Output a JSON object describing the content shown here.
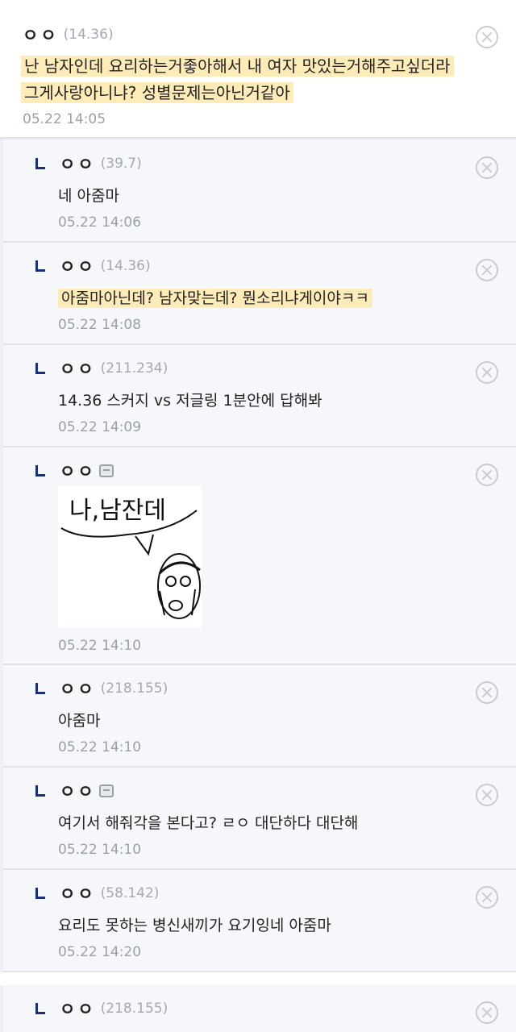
{
  "top_comment": {
    "nick": "ㅇㅇ",
    "ip": "(14.36)",
    "body_line1": "난 남자인데 요리하는거좋아해서 내 여자 맛있는거해주고싶더라",
    "body_line2": "그게사랑아니냐? 성별문제는아닌거같아",
    "date": "05.22 14:05"
  },
  "replies": [
    {
      "nick": "ㅇㅇ",
      "ip": "(39.7)",
      "body": "네 아줌마",
      "date": "05.22 14:06"
    },
    {
      "nick": "ㅇㅇ",
      "ip": "(14.36)",
      "body": "아줌마아닌데? 남자맞는데? 뭔소리냐게이야ㅋㅋ",
      "date": "05.22 14:08"
    },
    {
      "nick": "ㅇㅇ",
      "ip": "(211.234)",
      "body": "14.36 스커지 vs 저글링 1분안에 답해봐",
      "date": "05.22 14:09"
    },
    {
      "nick": "ㅇㅇ",
      "ip": "",
      "body": "",
      "image_text": "나,남잔데",
      "date": "05.22 14:10"
    },
    {
      "nick": "ㅇㅇ",
      "ip": "(218.155)",
      "body": "아줌마",
      "date": "05.22 14:10"
    },
    {
      "nick": "ㅇㅇ",
      "ip": "",
      "body": "여기서 해줘각을 본다고? ㄹㅇ 대단하다 대단해",
      "date": "05.22 14:10"
    },
    {
      "nick": "ㅇㅇ",
      "ip": "(58.142)",
      "body": "요리도 못하는 병신새끼가 요기잉네 아줌마",
      "date": "05.22 14:20"
    },
    {
      "nick": "ㅇㅇ",
      "ip": "(218.155)",
      "body": "",
      "date": ""
    }
  ],
  "colors": {
    "highlight": "#fdecb8",
    "reply_marker": "#1b2f7a",
    "date_gray": "#9aa0a8"
  }
}
